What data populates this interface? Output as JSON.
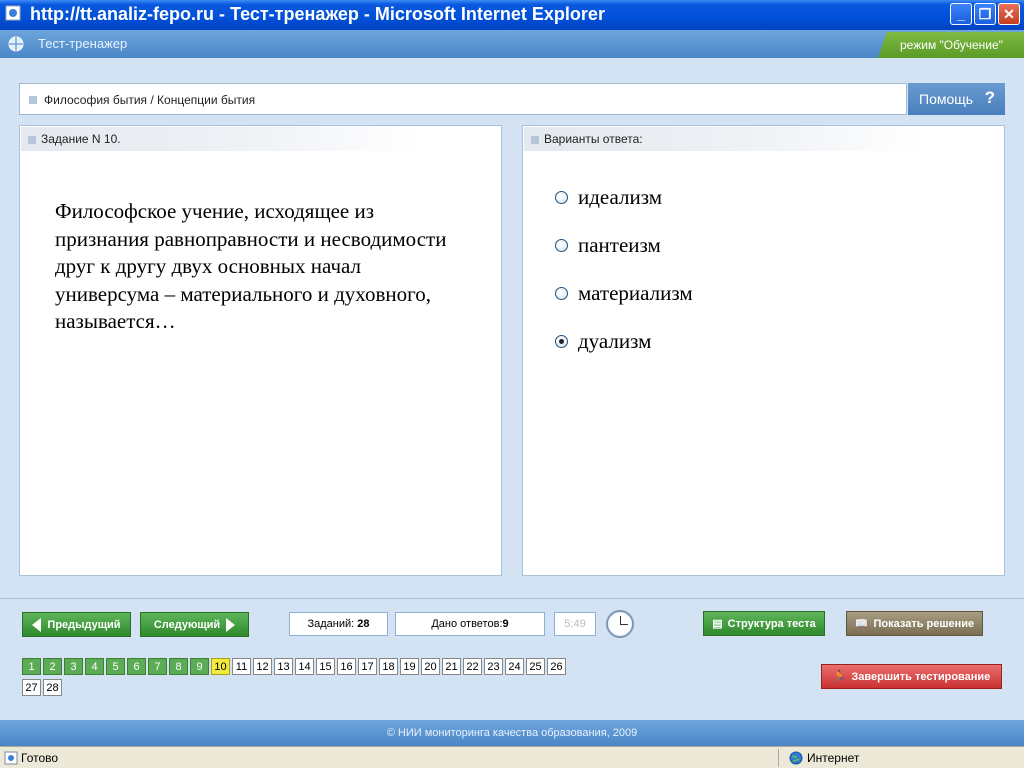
{
  "browser": {
    "title": "http://tt.analiz-fepo.ru - Тест-тренажер - Microsoft Internet Explorer",
    "status_text": "Готово",
    "zone_text": "Интернет"
  },
  "app": {
    "title": "Тест-тренажер",
    "mode": "режим \"Обучение\""
  },
  "breadcrumb": "Философия бытия / Концепции бытия",
  "help_label": "Помощь",
  "question": {
    "header": "Задание N 10.",
    "text": "Философское учение, исходящее из признания равноправности и несводимости друг к другу двух основных начал универсума – материального и духовного, называется…"
  },
  "answers": {
    "header": "Варианты ответа:",
    "options": [
      {
        "label": "идеализм",
        "selected": false
      },
      {
        "label": "пантеизм",
        "selected": false
      },
      {
        "label": "материализм",
        "selected": false
      },
      {
        "label": "дуализм",
        "selected": true
      }
    ]
  },
  "controls": {
    "prev_label": "Предыдущий",
    "next_label": "Следующий",
    "tasks_label": "Заданий:",
    "tasks_count": "28",
    "answered_label": "Дано ответов:",
    "answered_count": "9",
    "timer": "5:49",
    "structure_label": "Структура теста",
    "solution_label": "Показать решение",
    "finish_label": "Завершить тестирование"
  },
  "tasks": {
    "numbers": [
      "1",
      "2",
      "3",
      "4",
      "5",
      "6",
      "7",
      "8",
      "9",
      "10",
      "11",
      "12",
      "13",
      "14",
      "15",
      "16",
      "17",
      "18",
      "19",
      "20",
      "21",
      "22",
      "23",
      "24",
      "25",
      "26",
      "27",
      "28"
    ],
    "answered": [
      "1",
      "2",
      "3",
      "4",
      "5",
      "6",
      "7",
      "8",
      "9"
    ],
    "current": "10"
  },
  "footer": "© НИИ мониторинга качества образования, 2009",
  "colors": {
    "accent_blue": "#4a85c6",
    "done_green": "#5cab55",
    "current_yellow": "#f3ea3a",
    "finish_red": "#c93131"
  }
}
